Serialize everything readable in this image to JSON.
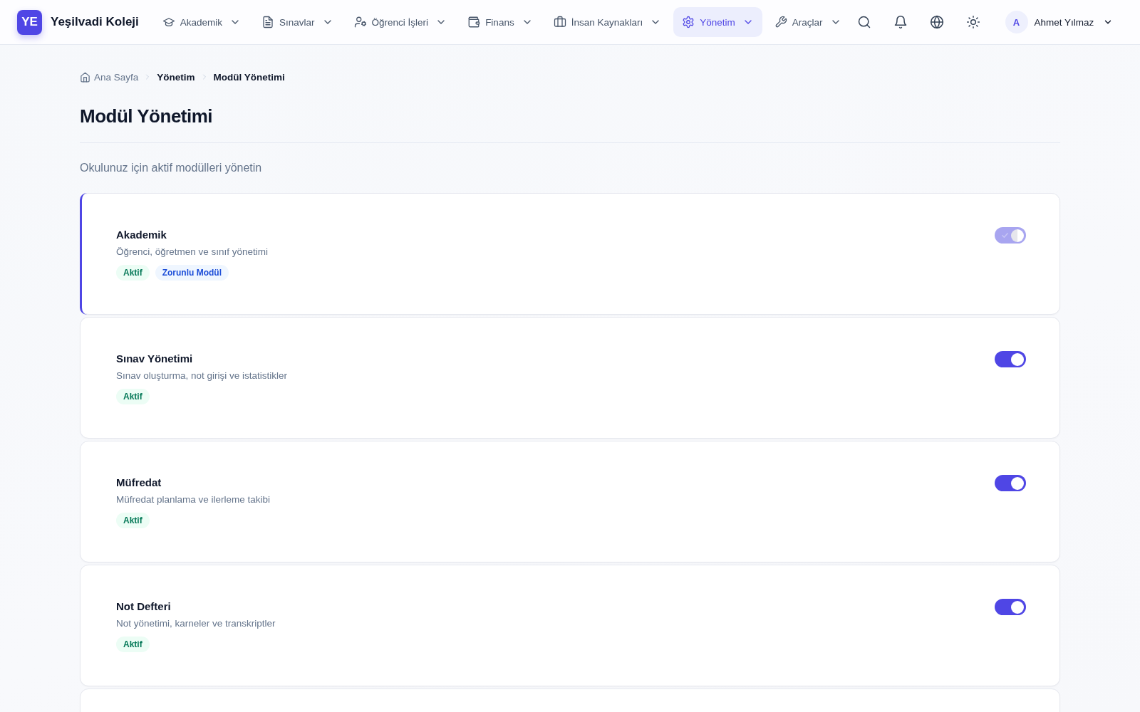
{
  "brand": {
    "logo": "YE",
    "name": "Yeşilvadi Koleji"
  },
  "nav": [
    {
      "label": "Akademik",
      "selected": false
    },
    {
      "label": "Sınavlar",
      "selected": false
    },
    {
      "label": "Öğrenci İşleri",
      "selected": false
    },
    {
      "label": "Finans",
      "selected": false
    },
    {
      "label": "İnsan Kaynakları",
      "selected": false
    },
    {
      "label": "Yönetim",
      "selected": true
    },
    {
      "label": "Araçlar",
      "selected": false
    }
  ],
  "user": {
    "initial": "A",
    "name": "Ahmet Yılmaz"
  },
  "breadcrumb": [
    "Ana Sayfa",
    "Yönetim",
    "Modül Yönetimi"
  ],
  "page": {
    "title": "Modül Yönetimi",
    "subtitle": "Okulunuz için aktif modülleri yönetin"
  },
  "modules": [
    {
      "name": "Akademik",
      "description": "Öğrenci, öğretmen ve sınıf yönetimi",
      "selected": true,
      "on": true,
      "disabled": true,
      "badges": [
        {
          "kind": "status",
          "label": "Aktif"
        },
        {
          "kind": "required",
          "label": "Zorunlu Modül"
        }
      ]
    },
    {
      "name": "Sınav Yönetimi",
      "description": "Sınav oluşturma, not girişi ve istatistikler",
      "selected": false,
      "on": true,
      "disabled": false,
      "badges": [
        {
          "kind": "status",
          "label": "Aktif"
        }
      ]
    },
    {
      "name": "Müfredat",
      "description": "Müfredat planlama ve ilerleme takibi",
      "selected": false,
      "on": true,
      "disabled": false,
      "badges": [
        {
          "kind": "status",
          "label": "Aktif"
        }
      ]
    },
    {
      "name": "Not Defteri",
      "description": "Not yönetimi, karneler ve transkriptler",
      "selected": false,
      "on": true,
      "disabled": false,
      "badges": [
        {
          "kind": "status",
          "label": "Aktif"
        }
      ]
    }
  ]
}
